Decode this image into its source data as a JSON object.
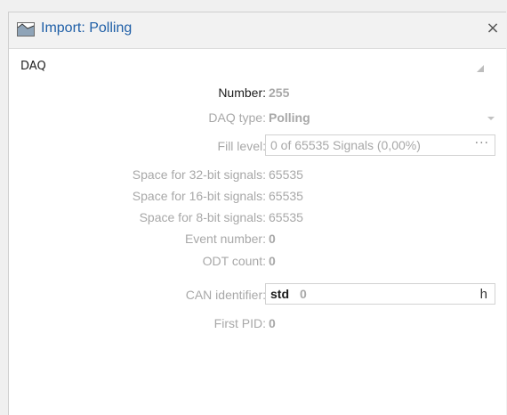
{
  "window": {
    "title": "Import: Polling",
    "icon": "import-icon",
    "close_glyph": "×"
  },
  "section": {
    "title": "DAQ",
    "collapse_icon": "collapse-triangle-icon"
  },
  "fields": {
    "number": {
      "label": "Number:",
      "value": "255"
    },
    "daq_type": {
      "label": "DAQ type:",
      "value": "Polling"
    },
    "fill_level": {
      "label": "Fill level:",
      "value": "0 of 65535 Signals (0,00%)",
      "button": "···"
    },
    "space32": {
      "label": "Space for 32-bit signals:",
      "value": "65535"
    },
    "space16": {
      "label": "Space for 16-bit signals:",
      "value": "65535"
    },
    "space8": {
      "label": "Space for 8-bit signals:",
      "value": "65535"
    },
    "event_number": {
      "label": "Event number:",
      "value": "0"
    },
    "odt_count": {
      "label": "ODT count:",
      "value": "0"
    },
    "can_identifier": {
      "label": "CAN identifier:",
      "type": "std",
      "value": "0",
      "suffix": "h"
    },
    "first_pid": {
      "label": "First PID:",
      "value": "0"
    }
  },
  "colors": {
    "title_text": "#1f5fa7",
    "label_disabled": "#a8a8a8",
    "label_enabled": "#1c1c1c",
    "border": "#d2d2d2"
  }
}
